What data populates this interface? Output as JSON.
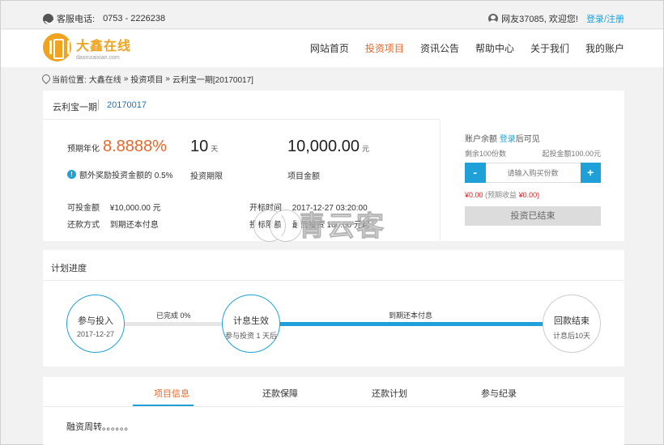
{
  "topbar": {
    "hotline_label": "客服电话:",
    "hotline_number": "0753 - 2226238",
    "greeting": "网友37085, 欢迎您!",
    "login": "登录",
    "slash": "/",
    "register": "注册"
  },
  "logo": {
    "name": "大鑫在线",
    "domain": "daxinzaixian.com"
  },
  "nav": {
    "items": [
      "网站首页",
      "投资项目",
      "资讯公告",
      "帮助中心",
      "关于我们",
      "我的账户"
    ],
    "active_index": 1
  },
  "breadcrumb": {
    "label": "当前位置:",
    "items": [
      "大鑫在线",
      "»",
      "投资项目",
      "»",
      "云利宝一期[20170017]"
    ]
  },
  "project": {
    "name": "云利宝一期",
    "code": "20170017",
    "rate_label": "预期年化",
    "rate_value": "8.8888%",
    "days_value": "10",
    "days_unit": "天",
    "amount_value": "10,000.00",
    "amount_unit": "元",
    "bonus_text": "额外奖励投资金额的 0.5%",
    "days_label": "投资期限",
    "amount_label": "项目金额",
    "available_label": "可投金额",
    "available_value": "¥10,000.00 元",
    "repay_label": "还款方式",
    "repay_value": "到期还本付息",
    "start_label": "开标时间",
    "start_value": "2017-12-27 03:20:00",
    "limit_label": "投标限额",
    "limit_value": "最低投资 100.00 元起"
  },
  "invest": {
    "balance_label": "账户余额",
    "balance_link": "登录",
    "balance_suffix": "后可见",
    "remain_text": "剩余100份数",
    "min_text": "起投金额100.00元",
    "minus": "-",
    "plus": "+",
    "input_placeholder": "请输入购买份数",
    "earn_amount": "¥0.00",
    "earn_label": "(预期收益",
    "earn_value": "¥0.00)",
    "button": "投资已结束"
  },
  "plan": {
    "title": "计划进度",
    "nodes": [
      {
        "title": "参与投入",
        "sub": "2017-12-27"
      },
      {
        "title": "计息生效",
        "sub": "参与投资 1 天后"
      },
      {
        "title": "回款结束",
        "sub": "计息后10天"
      }
    ],
    "progress_text": "已完成 0%",
    "repay_text": "到期还本付息"
  },
  "tabs": {
    "items": [
      "项目信息",
      "还款保障",
      "还款计划",
      "参与纪录"
    ],
    "active_index": 0,
    "body": "融资周转。。。。。。"
  },
  "watermark": "青云客",
  "colors": {
    "accent_blue": "#1fa0d8",
    "accent_orange": "#e8672a",
    "logo_gold": "#f0a31e",
    "red": "#e02020"
  }
}
